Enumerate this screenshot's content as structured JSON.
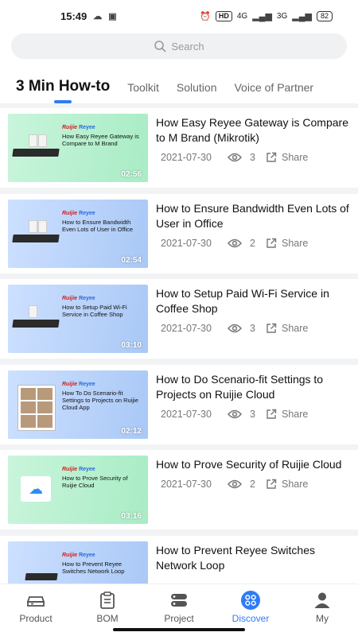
{
  "status_bar": {
    "time": "15:49",
    "hd_label": "HD",
    "net1": "4G",
    "net2": "3G",
    "battery": "82"
  },
  "search": {
    "placeholder": "Search"
  },
  "tabs": [
    {
      "label": "3 Min How-to"
    },
    {
      "label": "Toolkit"
    },
    {
      "label": "Solution"
    },
    {
      "label": "Voice of Partner"
    }
  ],
  "videos": [
    {
      "title": "How Easy Reyee Gateway is Compare to M Brand (Mikrotik)",
      "date": "2021-07-30",
      "views": "3",
      "share": "Share",
      "duration": "02:56",
      "thumb_brand": "Ruijie",
      "thumb_brand2": "Reyee",
      "thumb_title": "How Easy Reyee Gateway is Compare to M Brand"
    },
    {
      "title": "How to Ensure Bandwidth Even Lots of User in Office",
      "date": "2021-07-30",
      "views": "2",
      "share": "Share",
      "duration": "02:54",
      "thumb_brand": "Ruijie",
      "thumb_brand2": "Reyee",
      "thumb_title": "How to Ensure Bandwidth Even Lots of User in Office"
    },
    {
      "title": "How to Setup Paid Wi-Fi Service in Coffee Shop",
      "date": "2021-07-30",
      "views": "3",
      "share": "Share",
      "duration": "03:10",
      "thumb_brand": "Ruijie",
      "thumb_brand2": "Reyee",
      "thumb_title": "How to Setup Paid Wi-Fi Service in Coffee Shop"
    },
    {
      "title": "How to Do Scenario-fit Settings to Projects on Ruijie Cloud",
      "date": "2021-07-30",
      "views": "3",
      "share": "Share",
      "duration": "02:12",
      "thumb_brand": "Ruijie",
      "thumb_brand2": "Reyee",
      "thumb_title": "How To Do Scenario-fit Settings to Projects on Ruijie Cloud App"
    },
    {
      "title": "How to Prove Security of Ruijie Cloud",
      "date": "2021-07-30",
      "views": "2",
      "share": "Share",
      "duration": "03:16",
      "thumb_brand": "Ruijie",
      "thumb_brand2": "Reyee",
      "thumb_title": "How to Prove Security of Ruijie Cloud"
    },
    {
      "title": "How to Prevent Reyee Switches Network Loop",
      "date": "",
      "views": "",
      "share": "",
      "duration": "",
      "thumb_brand": "Ruijie",
      "thumb_brand2": "Reyee",
      "thumb_title": "How to Prevent Reyee Switches Network Loop"
    }
  ],
  "bottom_nav": [
    {
      "label": "Product",
      "icon": "router-icon"
    },
    {
      "label": "BOM",
      "icon": "list-doc-icon"
    },
    {
      "label": "Project",
      "icon": "stack-icon"
    },
    {
      "label": "Discover",
      "icon": "discover-icon"
    },
    {
      "label": "My",
      "icon": "person-icon"
    }
  ],
  "colors": {
    "accent": "#2f7bf5",
    "brand_red": "#d31c1c"
  }
}
